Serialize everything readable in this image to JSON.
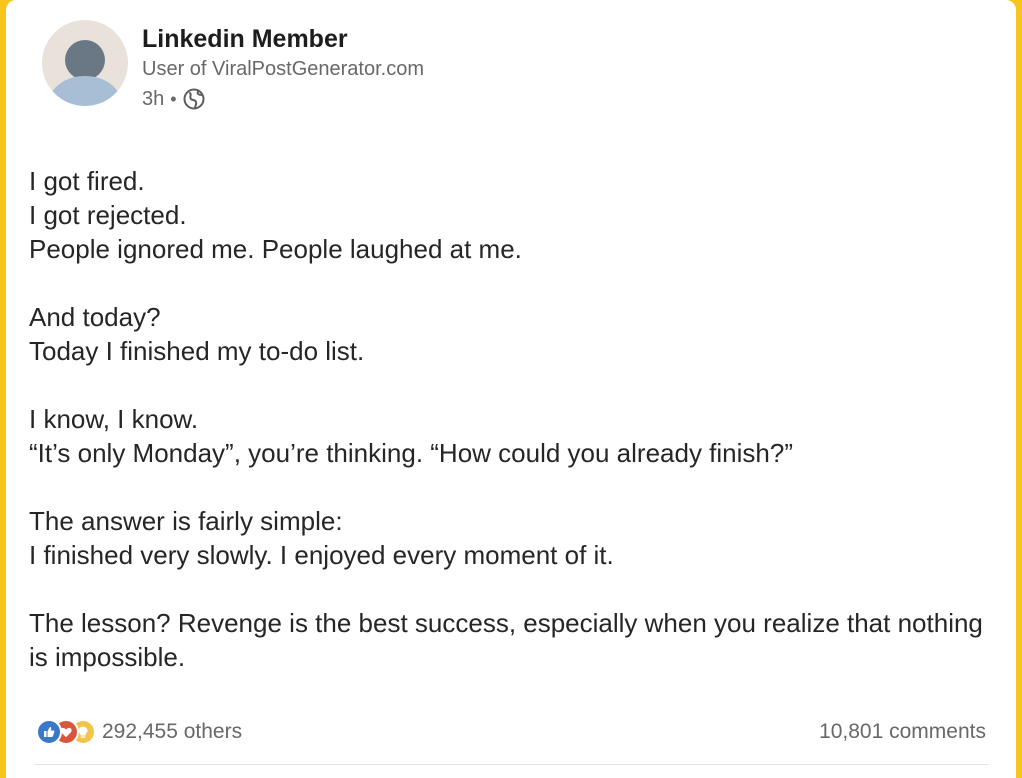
{
  "author": {
    "name": "Linkedin Member",
    "headline": "User of ViralPostGenerator.com",
    "time": "3h",
    "separator": "•",
    "visibility_icon": "globe-icon"
  },
  "post": {
    "paragraphs": [
      [
        "I got fired.",
        "I got rejected.",
        "People ignored me. People laughed at me."
      ],
      [
        "And today?",
        "Today I finished my to-do list."
      ],
      [
        "I know, I know.",
        "“It’s only Monday”, you’re thinking. “How could you already finish?”"
      ],
      [
        "The answer is fairly simple:",
        "I finished very slowly. I enjoyed every moment of it."
      ],
      [
        "The lesson? Revenge is the best success, especially when you realize that nothing is impossible."
      ]
    ]
  },
  "social": {
    "reaction_icons": [
      "like-icon",
      "love-icon",
      "insightful-icon"
    ],
    "reactions_label": "292,455 others",
    "comments_label": "10,801 comments"
  },
  "colors": {
    "frame": "#f7c51b",
    "card": "#ffffff",
    "text": "#262626",
    "muted": "#686868",
    "like": "#3a78c9",
    "love": "#d9563c",
    "insightful": "#f2c54a"
  }
}
